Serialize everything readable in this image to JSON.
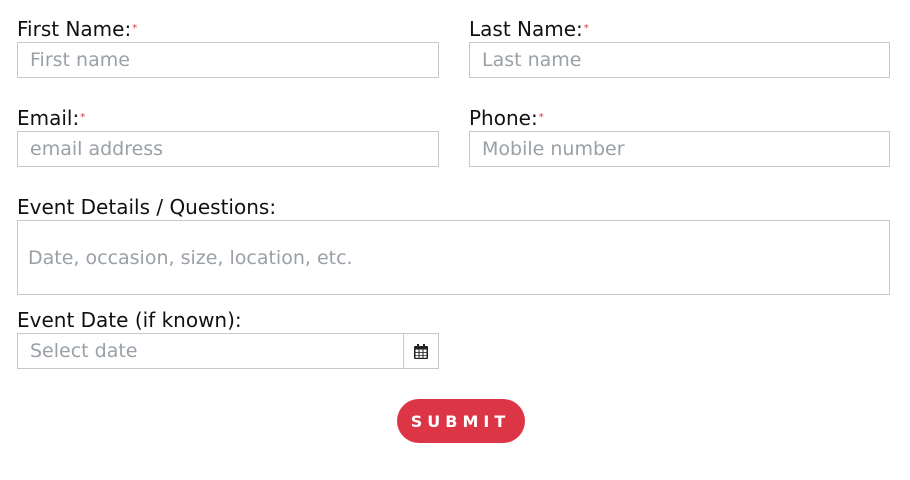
{
  "form": {
    "first_name": {
      "label": "First Name:",
      "required_mark": "*",
      "placeholder": "First name",
      "value": ""
    },
    "last_name": {
      "label": "Last Name:",
      "required_mark": "*",
      "placeholder": "Last name",
      "value": ""
    },
    "email": {
      "label": "Email:",
      "required_mark": "*",
      "placeholder": "email address",
      "value": ""
    },
    "phone": {
      "label": "Phone:",
      "required_mark": "*",
      "placeholder": "Mobile number",
      "value": ""
    },
    "details": {
      "label": "Event Details / Questions:",
      "placeholder": "Date, occasion, size, location, etc.",
      "value": ""
    },
    "event_date": {
      "label": "Event Date (if known):",
      "placeholder": "Select date",
      "value": "",
      "icon": "calendar-icon"
    },
    "submit_label": "SUBMIT"
  },
  "colors": {
    "accent": "#dc3545",
    "border": "#c8c8c8",
    "placeholder": "#9aa0a6"
  }
}
